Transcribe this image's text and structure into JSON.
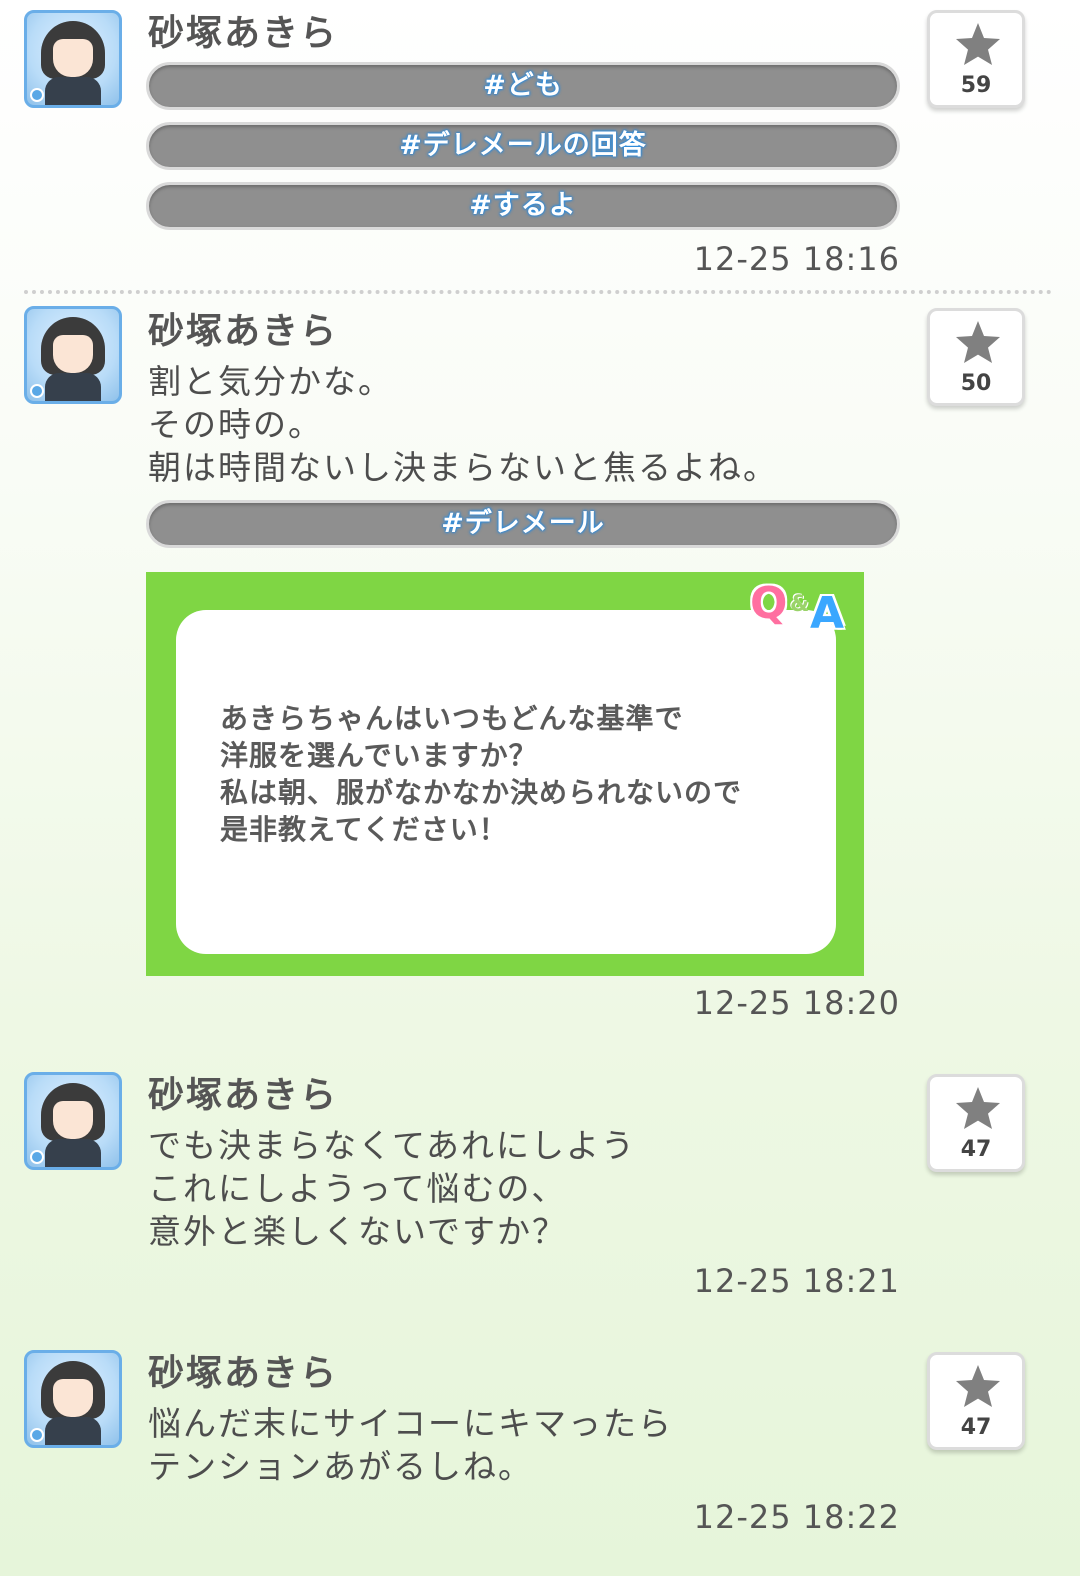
{
  "icons": {
    "star": "star-icon",
    "avatar": "avatar"
  },
  "colors": {
    "tag_bg": "#8f8f8f",
    "tag_text_glow": "#2e8fe0",
    "qa_green": "#7fd644"
  },
  "posts": [
    {
      "author": "砂塚あきら",
      "lines": [],
      "tags": [
        "#ども",
        "#デレメールの回答",
        "#するよ"
      ],
      "time": "12-25 18:16",
      "likes": "59"
    },
    {
      "author": "砂塚あきら",
      "lines": [
        "割と気分かな。",
        "その時の。",
        "朝は時間ないし決まらないと焦るよね。"
      ],
      "tags": [
        "#デレメール"
      ],
      "qa": {
        "badge_q": "Q",
        "badge_amp": "&",
        "badge_a": "A",
        "lines": [
          "あきらちゃんはいつもどんな基準で",
          "洋服を選んでいますか？",
          "私は朝、服がなかなか決められないので",
          "是非教えてください！"
        ]
      },
      "time": "12-25 18:20",
      "likes": "50"
    },
    {
      "author": "砂塚あきら",
      "lines": [
        "でも決まらなくてあれにしよう",
        "これにしようって悩むの、",
        "意外と楽しくないですか？"
      ],
      "tags": [],
      "time": "12-25 18:21",
      "likes": "47"
    },
    {
      "author": "砂塚あきら",
      "lines": [
        "悩んだ末にサイコーにキマったら",
        "テンションあがるしね。"
      ],
      "tags": [],
      "time": "12-25 18:22",
      "likes": "47"
    }
  ]
}
